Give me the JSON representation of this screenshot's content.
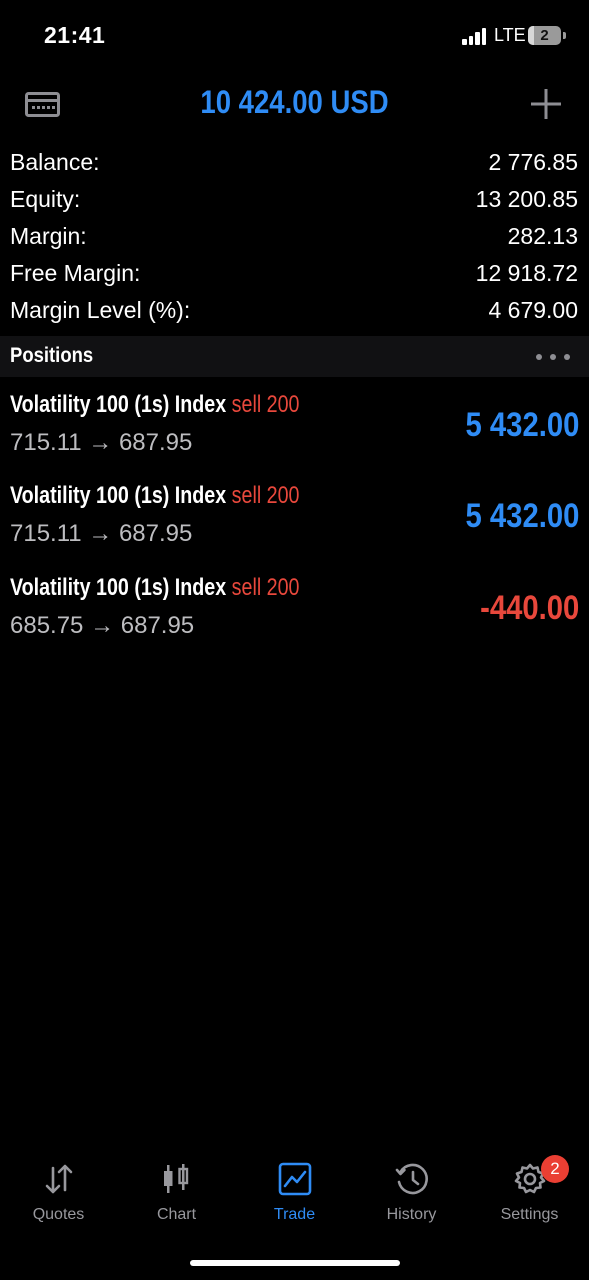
{
  "status_bar": {
    "time": "21:41",
    "network": "LTE",
    "battery_level": "2"
  },
  "header": {
    "title": "10 424.00 USD",
    "left_icon": "card-icon",
    "right_icon": "plus-icon"
  },
  "summary": {
    "rows": [
      {
        "label": "Balance:",
        "value": "2 776.85"
      },
      {
        "label": "Equity:",
        "value": "13 200.85"
      },
      {
        "label": "Margin:",
        "value": "282.13"
      },
      {
        "label": "Free Margin:",
        "value": "12 918.72"
      },
      {
        "label": "Margin Level (%):",
        "value": "4 679.00"
      }
    ]
  },
  "positions": {
    "title": "Positions",
    "items": [
      {
        "symbol": "Volatility 100 (1s) Index",
        "side": "sell 200",
        "prices": "715.11 → 687.95",
        "profit": "5 432.00"
      },
      {
        "symbol": "Volatility 100 (1s) Index",
        "side": "sell 200",
        "prices": "715.11 → 687.95",
        "profit": "5 432.00"
      },
      {
        "symbol": "Volatility 100 (1s) Index",
        "side": "sell 200",
        "prices": "685.75 → 687.95",
        "profit": "-440.00"
      }
    ]
  },
  "tabs": [
    {
      "label": "Quotes",
      "icon": "quotes-icon"
    },
    {
      "label": "Chart",
      "icon": "chart-icon"
    },
    {
      "label": "Trade",
      "icon": "trade-icon",
      "active": true
    },
    {
      "label": "History",
      "icon": "history-icon"
    },
    {
      "label": "Settings",
      "icon": "settings-icon",
      "badge": "2"
    }
  ],
  "colors": {
    "accent": "#2f8cf5",
    "profit": "#2f8cf5",
    "loss": "#e8483c",
    "badge": "#ea3f33"
  }
}
